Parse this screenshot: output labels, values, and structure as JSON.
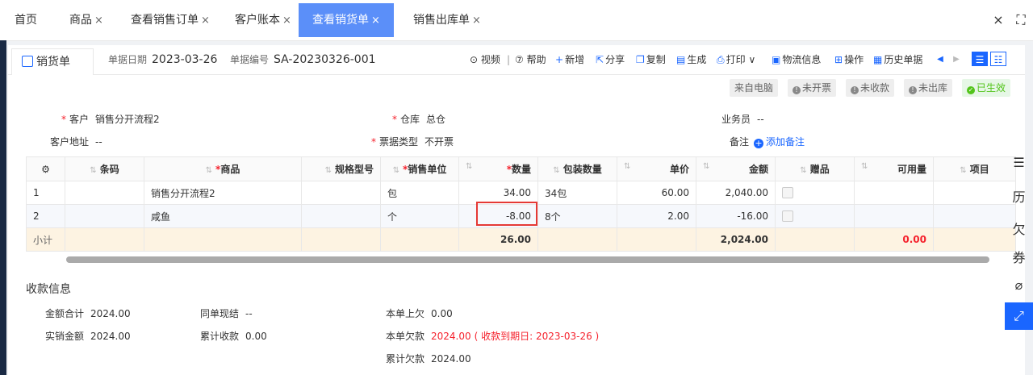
{
  "tabs": [
    {
      "label": "首页",
      "closable": false
    },
    {
      "label": "商品",
      "closable": true
    },
    {
      "label": "查看销售订单",
      "closable": true
    },
    {
      "label": "客户账本",
      "closable": true
    },
    {
      "label": "查看销货单",
      "closable": true,
      "active": true
    },
    {
      "label": "销售出库单",
      "closable": true
    }
  ],
  "tab_close_symbol": "×",
  "tabbar_icons": [
    "close-icon",
    "fullscreen-icon"
  ],
  "doc": {
    "tab_label": "销货单",
    "date_label": "单据日期",
    "date": "2023-03-26",
    "no_label": "单据编号",
    "no": "SA-20230326-001"
  },
  "toolbar": {
    "video": "视频",
    "sep": "|",
    "help": "帮助",
    "new": "新增",
    "share": "分享",
    "copy": "复制",
    "generate": "生成",
    "print": "打印",
    "logistics": "物流信息",
    "operate": "操作",
    "history": "历史单据"
  },
  "status": {
    "source": "来自电脑",
    "invoice": "未开票",
    "received": "未收款",
    "outbound": "未出库",
    "effective": "已生效",
    "effective_color": "#52c41a"
  },
  "form": {
    "customer_label": "客户",
    "customer": "销售分开流程2",
    "warehouse_label": "仓库",
    "warehouse": "总仓",
    "salesman_label": "业务员",
    "salesman": "--",
    "address_label": "客户地址",
    "address": "--",
    "invoice_type_label": "票据类型",
    "invoice_type": "不开票",
    "remark_label": "备注",
    "remark_add": "添加备注"
  },
  "table": {
    "headers": {
      "barcode": "条码",
      "product": "商品",
      "spec": "规格型号",
      "unit": "销售单位",
      "qty": "数量",
      "pack": "包装数量",
      "price": "单价",
      "amount": "金额",
      "gift": "赠品",
      "available": "可用量",
      "project": "项目"
    },
    "rows": [
      {
        "no": "1",
        "barcode": "",
        "product": "销售分开流程2",
        "spec": "",
        "unit": "包",
        "qty": "34.00",
        "pack": "34包",
        "price": "60.00",
        "amount": "2,040.00",
        "available": "",
        "project": ""
      },
      {
        "no": "2",
        "barcode": "",
        "product": "咸鱼",
        "spec": "",
        "unit": "个",
        "qty": "-8.00",
        "pack": "8个",
        "price": "2.00",
        "amount": "-16.00",
        "available": "",
        "project": ""
      }
    ],
    "subtotal": {
      "label": "小计",
      "qty": "26.00",
      "amount": "2,024.00",
      "available": "0.00"
    }
  },
  "payment": {
    "title": "收款信息",
    "total_label": "金额合计",
    "total": "2024.00",
    "actual_label": "实销金额",
    "actual": "2024.00",
    "settle_label": "同单现结",
    "settle": "--",
    "cum_received_label": "累计收款",
    "cum_received": "0.00",
    "prev_owe_label": "本单上欠",
    "prev_owe": "0.00",
    "owe_label": "本单欠款",
    "owe": "2024.00",
    "owe_due": "( 收款到期日: 2023-03-26 )",
    "cum_owe_label": "累计欠款",
    "cum_owe": "2024.00"
  },
  "right_sidebar": [
    {
      "icon": "document-icon",
      "glyph": "☰"
    },
    {
      "icon": "history-icon",
      "glyph": "历"
    },
    {
      "icon": "owe-icon",
      "glyph": "欠"
    },
    {
      "icon": "coupon-icon",
      "glyph": "券"
    },
    {
      "icon": "attachment-icon",
      "glyph": "⌀"
    },
    {
      "icon": "expand-icon",
      "glyph": "⤢",
      "active": true
    }
  ],
  "colors": {
    "accent": "#1a66ff",
    "active_tab": "#5b8ff9",
    "error": "#f5222d",
    "subtotal_bg": "#fdf3e2"
  }
}
